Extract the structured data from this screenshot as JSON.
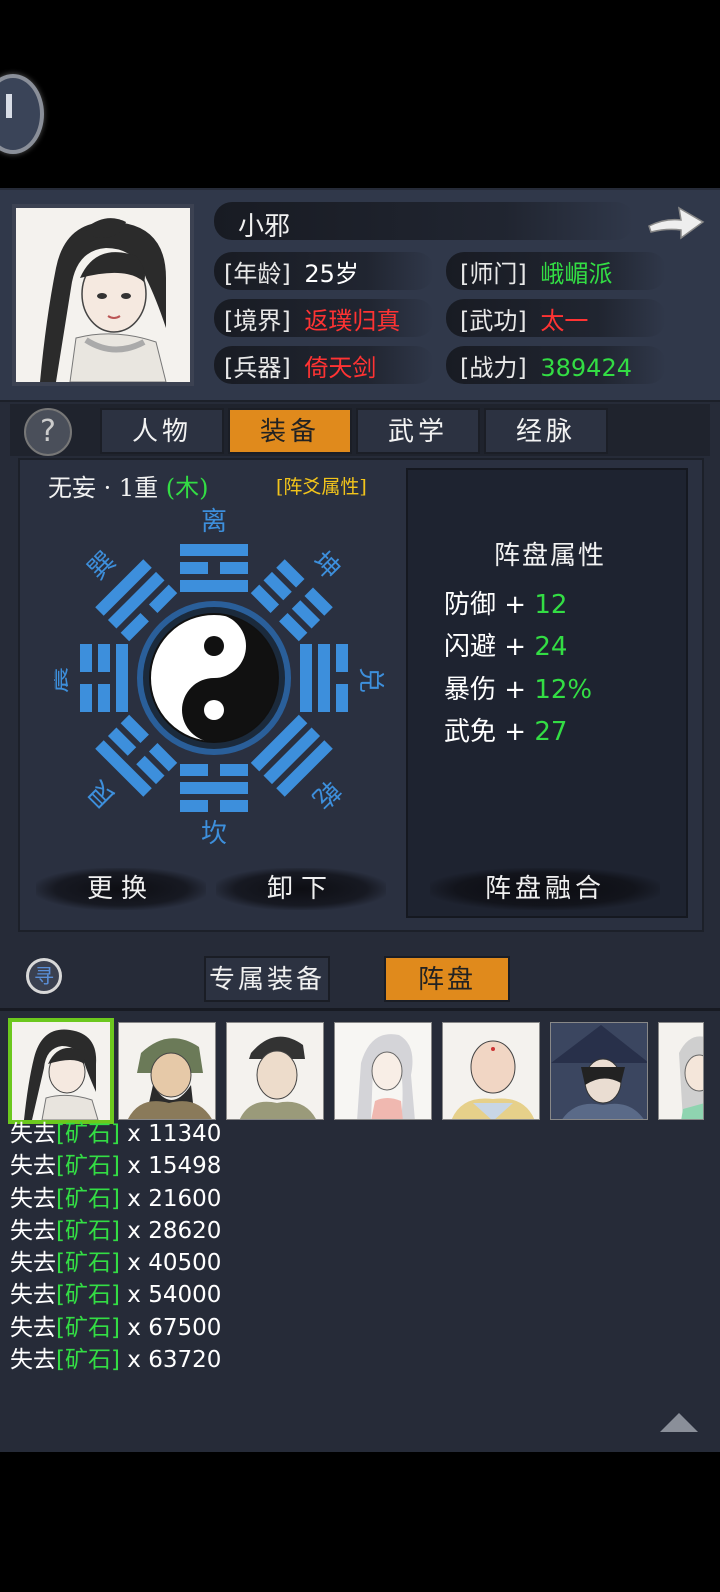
{
  "character": {
    "name": "小邪",
    "fields": [
      {
        "label": "[年龄]",
        "value": "25岁",
        "color": "#ffffff"
      },
      {
        "label": "[师门]",
        "value": "峨嵋派",
        "color": "#33dd44"
      },
      {
        "label": "[境界]",
        "value": "返璞归真",
        "color": "#ff3333"
      },
      {
        "label": "[武功]",
        "value": "太一",
        "color": "#ff3333"
      },
      {
        "label": "[兵器]",
        "value": "倚天剑",
        "color": "#ff3333"
      },
      {
        "label": "[战力]",
        "value": "389424",
        "color": "#33dd44"
      }
    ]
  },
  "tabs": [
    {
      "label": "人物",
      "active": false
    },
    {
      "label": "装备",
      "active": true
    },
    {
      "label": "武学",
      "active": false
    },
    {
      "label": "经脉",
      "active": false
    }
  ],
  "formation": {
    "name": "无妄 · 1重",
    "element": "(木)",
    "tag": "[阵爻属性]",
    "trigrams": [
      "离",
      "坤",
      "兑",
      "乾",
      "坎",
      "艮",
      "震",
      "巽"
    ],
    "accent_color": "#3d8fdc"
  },
  "attributes": {
    "title": "阵盘属性",
    "stats": [
      {
        "name": "防御",
        "value": "12"
      },
      {
        "name": "闪避",
        "value": "24"
      },
      {
        "name": "暴伤",
        "value": "12%"
      },
      {
        "name": "武免",
        "value": "27"
      }
    ]
  },
  "buttons": {
    "replace": "更换",
    "unequip": "卸下",
    "fuse": "阵盘融合"
  },
  "subtabs": [
    {
      "label": "专属装备",
      "active": false
    },
    {
      "label": "阵盘",
      "active": true
    }
  ],
  "search_glyph": "寻",
  "log": [
    {
      "prefix": "失去",
      "item": "[矿石]",
      "amount": "x 11340"
    },
    {
      "prefix": "失去",
      "item": "[矿石]",
      "amount": "x 15498"
    },
    {
      "prefix": "失去",
      "item": "[矿石]",
      "amount": "x 21600"
    },
    {
      "prefix": "失去",
      "item": "[矿石]",
      "amount": "x 28620"
    },
    {
      "prefix": "失去",
      "item": "[矿石]",
      "amount": "x 40500"
    },
    {
      "prefix": "失去",
      "item": "[矿石]",
      "amount": "x 54000"
    },
    {
      "prefix": "失去",
      "item": "[矿石]",
      "amount": "x 67500"
    },
    {
      "prefix": "失去",
      "item": "[矿石]",
      "amount": "x 63720"
    }
  ],
  "icons": {
    "back": "back-button-icon",
    "next": "arrow-right-icon",
    "help": "help-icon",
    "search": "search-icon",
    "scroll_top": "scroll-up-icon"
  }
}
